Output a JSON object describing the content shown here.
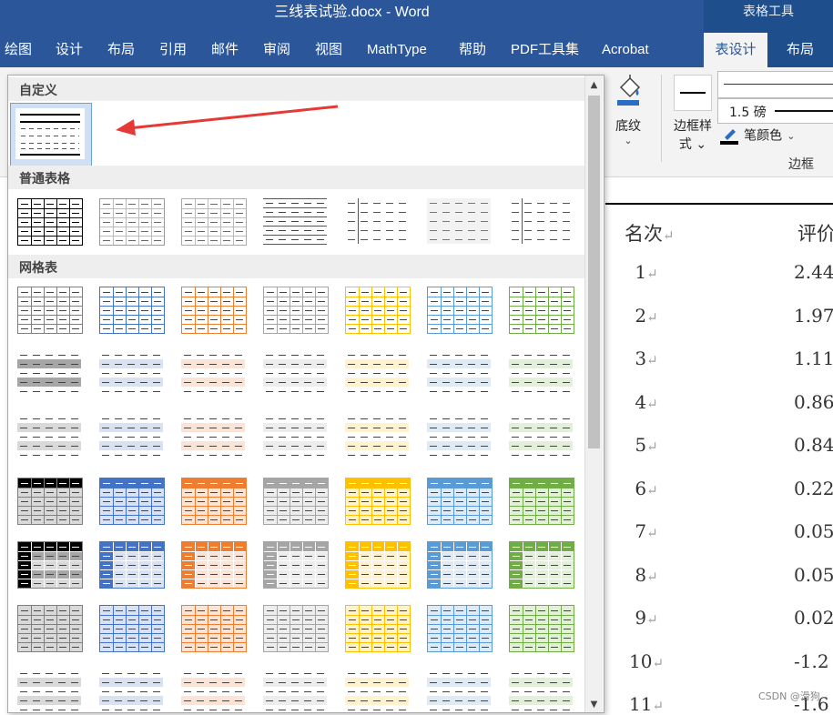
{
  "window": {
    "title": "三线表试验.docx  -  Word",
    "context_tab_group": "表格工具"
  },
  "ribbon_tabs": [
    "绘图",
    "设计",
    "布局",
    "引用",
    "邮件",
    "审阅",
    "视图",
    "MathType",
    "帮助",
    "PDF工具集",
    "Acrobat"
  ],
  "context_tabs": {
    "active": "表设计",
    "other": "布局"
  },
  "ribbon": {
    "shading_label": "底纹",
    "border_styles_label_1": "边框样",
    "border_styles_label_2": "式",
    "line_weight": "1.5 磅",
    "pen_color_label": "笔颜色",
    "borders_group_label": "边框",
    "chevron": "⌄",
    "colors": {
      "pen_color": "#000000",
      "accent": "#2b579a"
    }
  },
  "gallery": {
    "sections": {
      "custom": "自定义",
      "plain": "普通表格",
      "grid": "网格表"
    },
    "plain_styles": [
      {
        "lines": "#000",
        "border": "#000",
        "grid": "#000",
        "fill": "#fff"
      },
      {
        "lines": "#666",
        "border": "#999",
        "grid": "#bbb",
        "fill": "#fff"
      },
      {
        "lines": "#666",
        "border": "#aaa",
        "grid": "#bbb",
        "fill": "#fff"
      },
      {
        "lines": "#444",
        "border": "none",
        "grid": "none",
        "fill": "#fff",
        "hlines": true
      },
      {
        "lines": "#555",
        "border": "none",
        "grid": "none",
        "fill": "#fff",
        "vline": true
      },
      {
        "lines": "#777",
        "border": "none",
        "grid": "none",
        "fill": "#f2f2f2"
      },
      {
        "lines": "#555",
        "border": "none",
        "grid": "none",
        "fill": "#fff",
        "vline": true
      }
    ],
    "grid_colors": [
      "#7f7f7f",
      "#4472c4",
      "#ed7d31",
      "#a5a5a5",
      "#ffc000",
      "#5b9bd5",
      "#70ad47"
    ],
    "grid_tints": [
      "#d9d9d9",
      "#d9e2f3",
      "#fbe4d5",
      "#ededed",
      "#fff2cc",
      "#deeaf6",
      "#e2efd9"
    ],
    "dark_header": "#000000",
    "icons": [
      "arrow-icon",
      "scroll-up-icon",
      "scroll-down-icon",
      "shading-icon",
      "pen-color-icon"
    ]
  },
  "document": {
    "header_rank": "名次",
    "header_eval": "评价",
    "return_mark": "↵",
    "rows": [
      {
        "rank": "1",
        "value": "2.44"
      },
      {
        "rank": "2",
        "value": "1.97"
      },
      {
        "rank": "3",
        "value": "1.11"
      },
      {
        "rank": "4",
        "value": "0.86"
      },
      {
        "rank": "5",
        "value": "0.84"
      },
      {
        "rank": "6",
        "value": "0.22"
      },
      {
        "rank": "7",
        "value": "0.05"
      },
      {
        "rank": "8",
        "value": "0.05"
      },
      {
        "rank": "9",
        "value": "0.02"
      },
      {
        "rank": "10",
        "value": "-1.2"
      },
      {
        "rank": "11",
        "value": "-1.6"
      }
    ],
    "watermark": "CSDN @滑狗"
  }
}
